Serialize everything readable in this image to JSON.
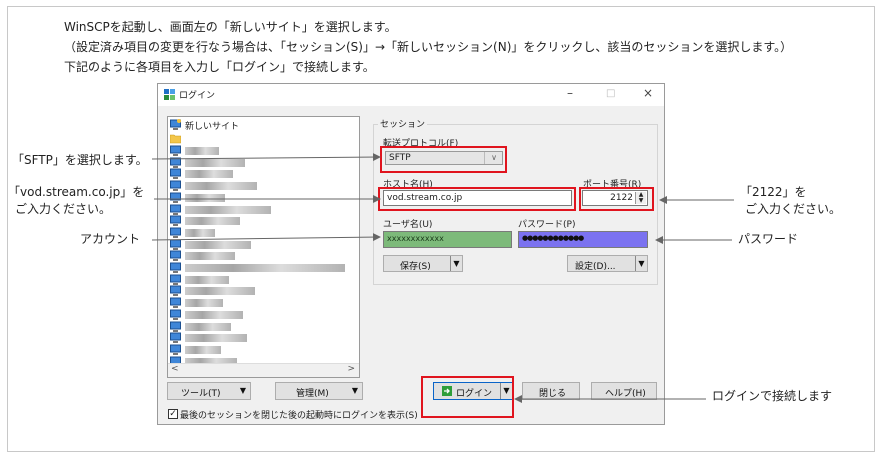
{
  "instructions": {
    "line1": "WinSCPを起動し、画面左の「新しいサイト」を選択します。",
    "line2": "（設定済み項目の変更を行なう場合は、「セッション(S)」→「新しいセッション(N)」をクリックし、該当のセッションを選択します。）",
    "line3": "下記のように各項目を入力し「ログイン」で接続します。"
  },
  "dialog": {
    "title": "ログイン",
    "controls": {
      "minimize": "–",
      "maximize": "□",
      "close": "×"
    },
    "site_list": {
      "new_site_label": "新しいサイト",
      "blurred_entries": 19,
      "scroll_left": "<",
      "scroll_right": ">"
    },
    "buttons": {
      "tools": "ツール(T)",
      "manage": "管理(M)",
      "login": "ログイン",
      "close": "閉じる",
      "help": "ヘルプ(H)",
      "save": "保存(S)",
      "settings": "設定(D)..."
    },
    "checkbox_label": "最後のセッションを閉じた後の起動時にログインを表示(S)",
    "checkbox_checked": true,
    "session": {
      "group_label": "セッション",
      "protocol_label": "転送プロトコル(F)",
      "protocol_value": "SFTP",
      "host_label": "ホスト名(H)",
      "host_value": "vod.stream.co.jp",
      "port_label": "ポート番号(R)",
      "port_value": "2122",
      "user_label": "ユーザ名(U)",
      "user_value": "xxxxxxxxxxxx",
      "password_label": "パスワード(P)",
      "password_value": "●●●●●●●●●●●●"
    }
  },
  "annotations": {
    "sftp": "「SFTP」を選択します。",
    "host_line1": "「vod.stream.co.jp」を",
    "host_line2": "ご入力ください。",
    "account": "アカウント",
    "port_line1": "「2122」を",
    "port_line2": "ご入力ください。",
    "password": "パスワード",
    "login": "ログインで接続します"
  },
  "colors": {
    "highlight_border": "#e0141e",
    "user_field_fill": "#7dba7a",
    "password_field_fill": "#7b72f0",
    "window_background": "#f0f0f0"
  }
}
